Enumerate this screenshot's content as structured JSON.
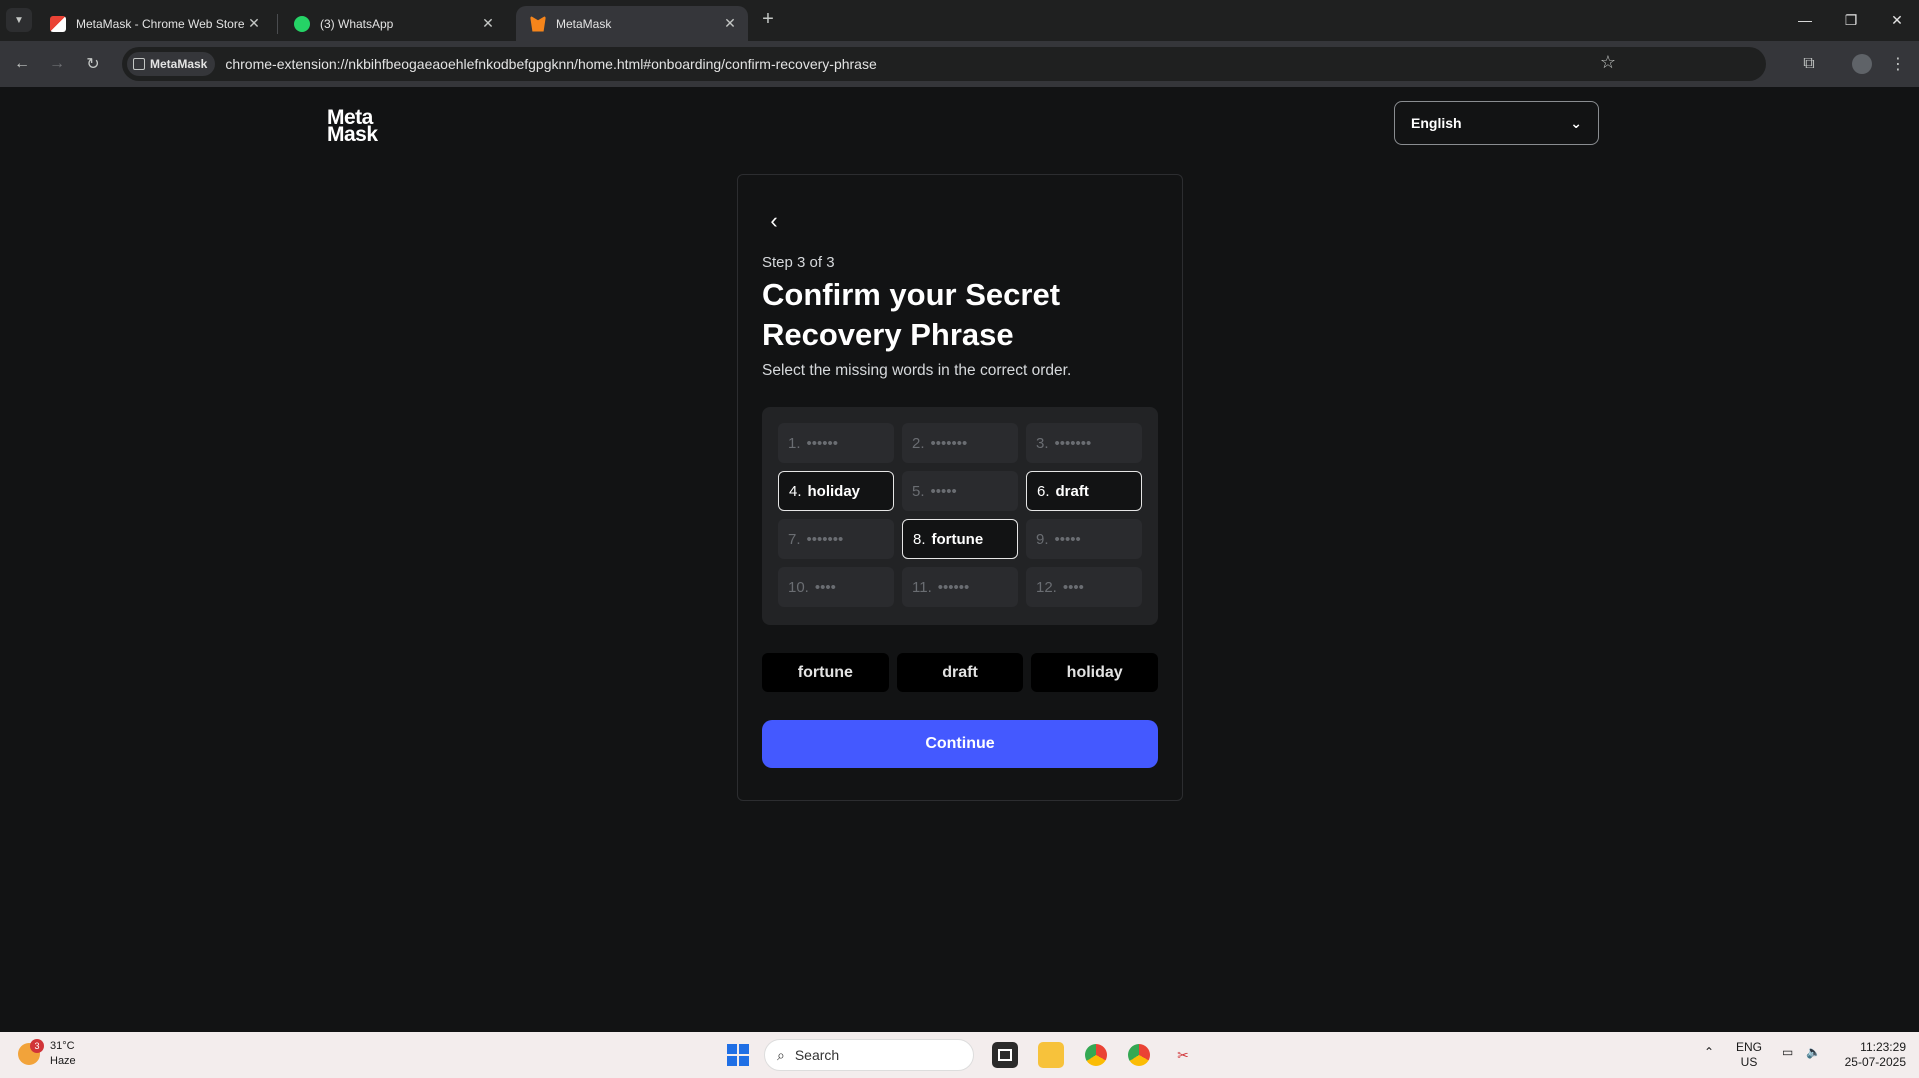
{
  "browser": {
    "tabs": [
      {
        "title": "MetaMask - Chrome Web Store",
        "favicon": "chrome-web-store-icon",
        "active": false
      },
      {
        "title": "(3) WhatsApp",
        "favicon": "whatsapp-icon",
        "active": false
      },
      {
        "title": "MetaMask",
        "favicon": "metamask-fox-icon",
        "active": true
      }
    ],
    "site_chip": "MetaMask",
    "url": "chrome-extension://nkbihfbeogaeaoehlefnkodbefgpgknn/home.html#onboarding/confirm-recovery-phrase"
  },
  "page": {
    "logo_line1": "Meta",
    "logo_line2": "Mask",
    "language": "English",
    "step": "Step 3 of 3",
    "heading": "Confirm your Secret Recovery Phrase",
    "subtext": "Select the missing words in the correct order.",
    "words": [
      {
        "num": "1.",
        "text": "••••••",
        "filled": false
      },
      {
        "num": "2.",
        "text": "•••••••",
        "filled": false
      },
      {
        "num": "3.",
        "text": "•••••••",
        "filled": false
      },
      {
        "num": "4.",
        "text": "holiday",
        "filled": true
      },
      {
        "num": "5.",
        "text": "•••••",
        "filled": false
      },
      {
        "num": "6.",
        "text": "draft",
        "filled": true
      },
      {
        "num": "7.",
        "text": "•••••••",
        "filled": false
      },
      {
        "num": "8.",
        "text": "fortune",
        "filled": true
      },
      {
        "num": "9.",
        "text": "•••••",
        "filled": false
      },
      {
        "num": "10.",
        "text": "••••",
        "filled": false
      },
      {
        "num": "11.",
        "text": "••••••",
        "filled": false
      },
      {
        "num": "12.",
        "text": "••••",
        "filled": false
      }
    ],
    "choices": [
      "fortune",
      "draft",
      "holiday"
    ],
    "continue_label": "Continue"
  },
  "taskbar": {
    "weather_badge": "3",
    "temperature": "31°C",
    "condition": "Haze",
    "search_placeholder": "Search",
    "lang_line1": "ENG",
    "lang_line2": "US",
    "time": "11:23:29",
    "date": "25-07-2025"
  }
}
